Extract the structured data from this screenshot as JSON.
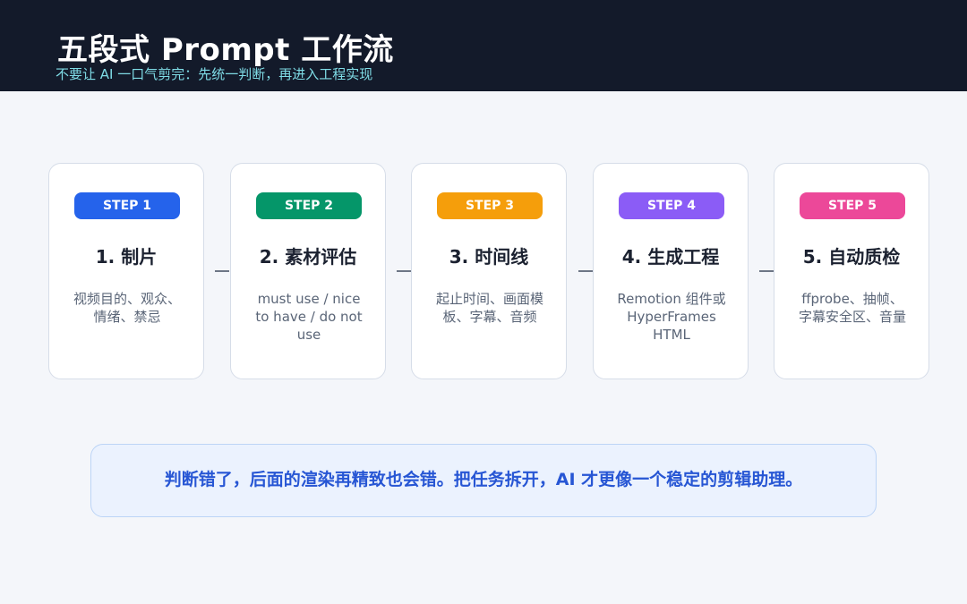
{
  "header": {
    "title": "五段式 Prompt 工作流",
    "subtitle": "不要让 AI 一口气剪完：先统一判断，再进入工程实现"
  },
  "steps": [
    {
      "badge": "STEP 1",
      "title": "1. 制片",
      "desc": "视频目的、观众、情绪、禁忌",
      "color": "#2563eb"
    },
    {
      "badge": "STEP 2",
      "title": "2. 素材评估",
      "desc": "must use / nice to have / do not use",
      "color": "#059669"
    },
    {
      "badge": "STEP 3",
      "title": "3. 时间线",
      "desc": "起止时间、画面模板、字幕、音频",
      "color": "#f59e0b"
    },
    {
      "badge": "STEP 4",
      "title": "4. 生成工程",
      "desc": "Remotion 组件或 HyperFrames HTML",
      "color": "#8b5cf6"
    },
    {
      "badge": "STEP 5",
      "title": "5. 自动质检",
      "desc": "ffprobe、抽帧、字幕安全区、音量",
      "color": "#ec4899"
    }
  ],
  "note": "判断错了，后面的渲染再精致也会错。把任务拆开，AI 才更像一个稳定的剪辑助理。"
}
